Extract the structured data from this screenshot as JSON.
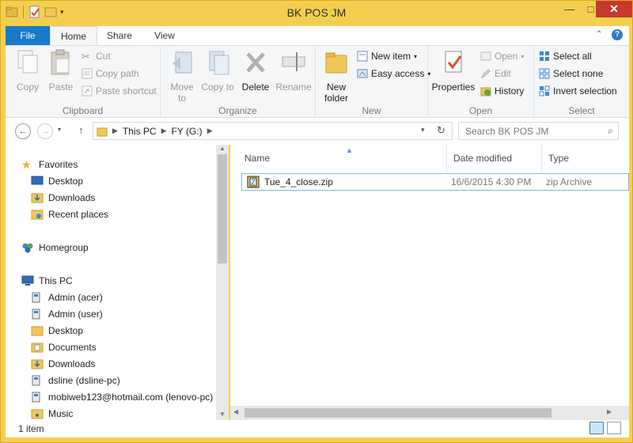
{
  "window": {
    "title": "BK POS JM",
    "minimize": "—",
    "maximize": "□",
    "close": "✕"
  },
  "tabs": {
    "file": "File",
    "home": "Home",
    "share": "Share",
    "view": "View",
    "collapse": "⌃",
    "help": "?"
  },
  "ribbon": {
    "clipboard": {
      "label": "Clipboard",
      "copy": "Copy",
      "paste": "Paste",
      "cut": "Cut",
      "copy_path": "Copy path",
      "paste_shortcut": "Paste shortcut"
    },
    "organize": {
      "label": "Organize",
      "move_to": "Move to",
      "copy_to": "Copy to",
      "delete": "Delete",
      "rename": "Rename"
    },
    "new": {
      "label": "New",
      "new_folder": "New folder",
      "new_item": "New item",
      "easy_access": "Easy access"
    },
    "open": {
      "label": "Open",
      "properties": "Properties",
      "open": "Open",
      "edit": "Edit",
      "history": "History"
    },
    "select": {
      "label": "Select",
      "select_all": "Select all",
      "select_none": "Select none",
      "invert_selection": "Invert selection"
    }
  },
  "address": {
    "crumbs": [
      "This PC",
      "FY (G:)"
    ],
    "search_placeholder": "Search BK POS JM"
  },
  "nav": {
    "favorites": "Favorites",
    "favorites_items": [
      "Desktop",
      "Downloads",
      "Recent places"
    ],
    "homegroup": "Homegroup",
    "this_pc": "This PC",
    "pc_items": [
      "Admin (acer)",
      "Admin (user)",
      "Desktop",
      "Documents",
      "Downloads",
      "dsline (dsline-pc)",
      "mobiweb123@hotmail.com (lenovo-pc)",
      "Music"
    ]
  },
  "files": {
    "columns": [
      "Name",
      "Date modified",
      "Type"
    ],
    "rows": [
      {
        "name": "Tue_4_close.zip",
        "date": "16/6/2015 4:30 PM",
        "type": "zip Archive"
      }
    ]
  },
  "status": {
    "count": "1 item"
  },
  "colors": {
    "frame": "#f4cf4f",
    "file_tab": "#1979ca",
    "selection_border": "#7eb4ea",
    "close_button": "#c7392c"
  }
}
